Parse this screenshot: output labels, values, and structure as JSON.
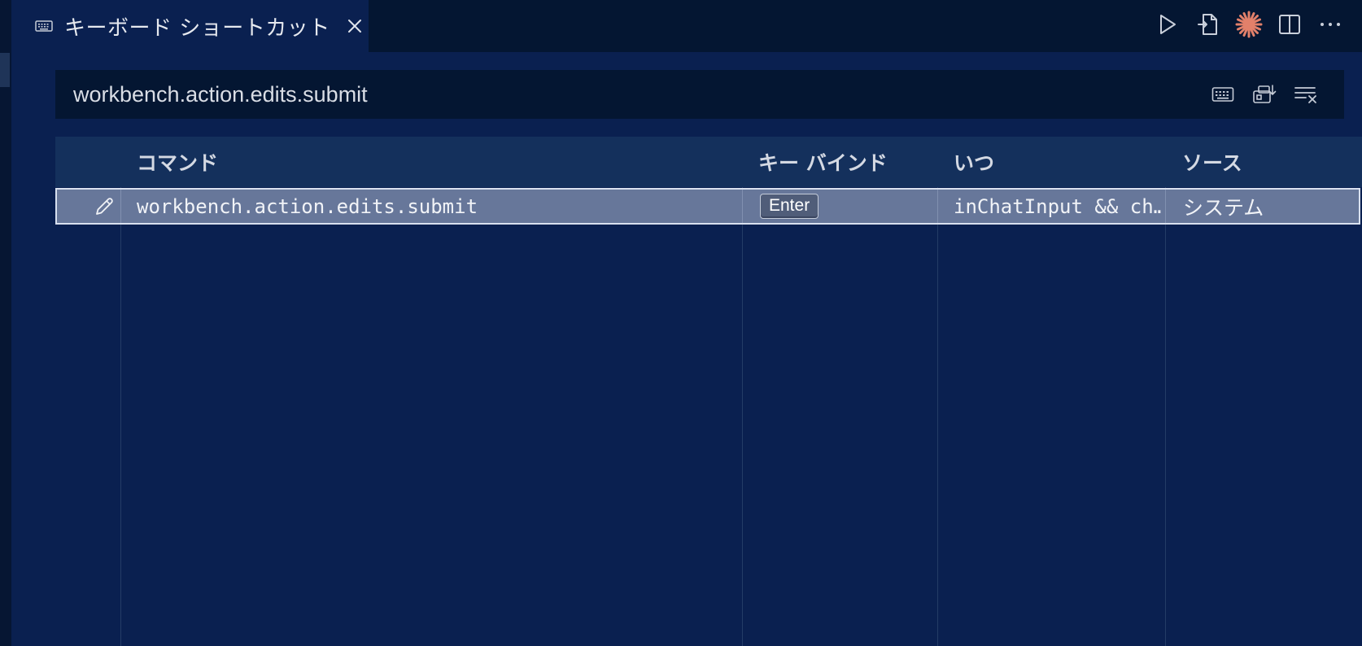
{
  "tab": {
    "title": "キーボード ショートカット",
    "icon": "keyboard-icon"
  },
  "toolbar": {
    "actions": [
      "run-icon",
      "open-json-icon",
      "assistant-burst-icon",
      "split-editor-icon",
      "more-actions-icon"
    ],
    "accent_color": "#e2806a"
  },
  "search": {
    "value": "workbench.action.edits.submit",
    "tools": [
      "record-keys-icon",
      "sort-by-precedence-icon",
      "clear-input-icon"
    ]
  },
  "table": {
    "headers": {
      "command": "コマンド",
      "keybinding": "キー バインド",
      "when": "いつ",
      "source": "ソース"
    },
    "rows": [
      {
        "command": "workbench.action.edits.submit",
        "keybinding": "Enter",
        "when": "inChatInput && ch…",
        "source": "システム",
        "selected": true
      }
    ]
  },
  "colors": {
    "background": "#0a2050",
    "tabbar": "#041632",
    "header": "#14305c",
    "selected_row": "#67779a",
    "selected_border": "#d8e0ef"
  }
}
